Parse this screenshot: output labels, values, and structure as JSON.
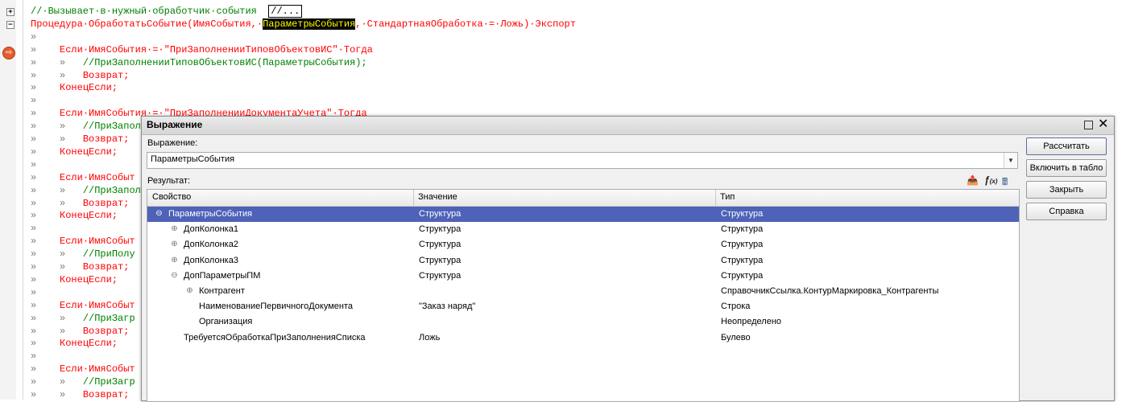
{
  "editor": {
    "lines": [
      {
        "kind": "comment-header",
        "text": "//·Вызывает·в·нужный·обработчик·события",
        "collapsed": "//..."
      },
      {
        "kind": "proc",
        "kw": "Процедура·",
        "name": "ОбработатьСобытие(ИмяСобытия,·",
        "hl": "ПараметрыСобытия",
        "rest": ",·СтандартнаяОбработка·=·Ложь)·Экспорт"
      },
      {
        "kind": "empty"
      },
      {
        "kind": "if",
        "text": "Если·ИмяСобытия·=·\"ПриЗаполненииТиповОбъектовИС\"·Тогда"
      },
      {
        "kind": "cm2",
        "text": "//ПриЗаполненииТиповОбъектовИС(ПараметрыСобытия);"
      },
      {
        "kind": "ret",
        "text": "Возврат;"
      },
      {
        "kind": "endif",
        "text": "КонецЕсли;"
      },
      {
        "kind": "empty"
      },
      {
        "kind": "if",
        "text": "Если·ИмяСобытия·=·\"ПриЗаполненииДокументаУчета\"·Тогда"
      },
      {
        "kind": "cm2",
        "text": "//ПриЗапол"
      },
      {
        "kind": "ret",
        "text": "Возврат;"
      },
      {
        "kind": "endif",
        "text": "КонецЕсли;"
      },
      {
        "kind": "empty"
      },
      {
        "kind": "if",
        "text": "Если·ИмяСобыт"
      },
      {
        "kind": "cm2",
        "text": "//ПриЗапол"
      },
      {
        "kind": "ret",
        "text": "Возврат;"
      },
      {
        "kind": "endif",
        "text": "КонецЕсли;"
      },
      {
        "kind": "empty"
      },
      {
        "kind": "if",
        "text": "Если·ИмяСобыт"
      },
      {
        "kind": "cm2",
        "text": "//ПриПолу"
      },
      {
        "kind": "ret",
        "text": "Возврат;"
      },
      {
        "kind": "endif",
        "text": "КонецЕсли;"
      },
      {
        "kind": "empty"
      },
      {
        "kind": "if",
        "text": "Если·ИмяСобыт"
      },
      {
        "kind": "cm2",
        "text": "//ПриЗагр"
      },
      {
        "kind": "ret",
        "text": "Возврат;"
      },
      {
        "kind": "endif",
        "text": "КонецЕсли;"
      },
      {
        "kind": "empty"
      },
      {
        "kind": "if",
        "text": "Если·ИмяСобыт"
      },
      {
        "kind": "cm2",
        "text": "//ПриЗагр"
      },
      {
        "kind": "ret",
        "text": "Возврат;"
      }
    ]
  },
  "dialog": {
    "title": "Выражение",
    "expression_label": "Выражение:",
    "expression_value": "ПараметрыСобытия",
    "result_label": "Результат:",
    "columns": [
      "Свойство",
      "Значение",
      "Тип"
    ],
    "rows": [
      {
        "indent": 0,
        "expander": "minus",
        "property": "ПараметрыСобытия",
        "value": "Структура",
        "type": "Структура",
        "selected": true
      },
      {
        "indent": 1,
        "expander": "plus",
        "property": "ДопКолонка1",
        "value": "Структура",
        "type": "Структура"
      },
      {
        "indent": 1,
        "expander": "plus",
        "property": "ДопКолонка2",
        "value": "Структура",
        "type": "Структура"
      },
      {
        "indent": 1,
        "expander": "plus",
        "property": "ДопКолонка3",
        "value": "Структура",
        "type": "Структура"
      },
      {
        "indent": 1,
        "expander": "minus",
        "property": "ДопПараметрыПМ",
        "value": "Структура",
        "type": "Структура"
      },
      {
        "indent": 2,
        "expander": "plus",
        "property": "Контрагент",
        "value": "",
        "type": "СправочникСсылка.КонтурМаркировка_Контрагенты"
      },
      {
        "indent": 2,
        "expander": "none",
        "property": "НаименованиеПервичногоДокумента",
        "value": "\"Заказ наряд\"",
        "type": "Строка"
      },
      {
        "indent": 2,
        "expander": "none",
        "property": "Организация",
        "value": "",
        "type": "Неопределено"
      },
      {
        "indent": 1,
        "expander": "none",
        "property": "ТребуетсяОбработкаПриЗаполненияСписка",
        "value": "Ложь",
        "type": "Булево"
      }
    ],
    "buttons": [
      "Рассчитать",
      "Включить в табло",
      "Закрыть",
      "Справка"
    ]
  }
}
